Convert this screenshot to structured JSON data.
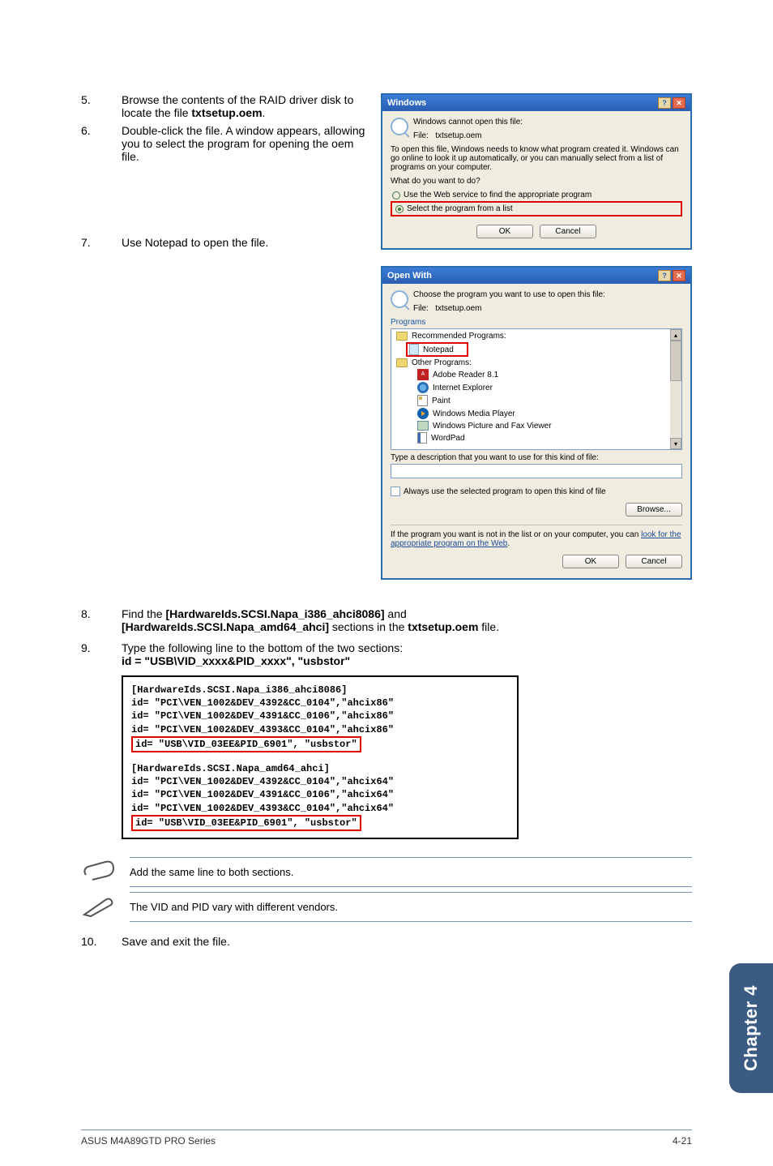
{
  "steps": {
    "s5_num": "5.",
    "s5": "Browse the contents of the RAID driver disk to locate the file ",
    "s5_bold": "txtsetup.oem",
    "s5_tail": ".",
    "s6_num": "6.",
    "s6": "Double-click the file. A window appears, allowing you to select the program for opening the oem file.",
    "s7_num": "7.",
    "s7": "Use Notepad to open the file.",
    "s8_num": "8.",
    "s8_a": "Find the ",
    "s8_b1": "[HardwareIds.SCSI.Napa_i386_ahci8086]",
    "s8_mid": " and ",
    "s8_b2": "[HardwareIds.SCSI.Napa_amd64_ahci]",
    "s8_c": " sections in the ",
    "s8_b3": "txtsetup.oem",
    "s8_d": " file.",
    "s9_num": "9.",
    "s9_a": "Type the following line to the bottom of the two sections:",
    "s9_b": "id = \"USB\\VID_xxxx&PID_xxxx\", \"usbstor\"",
    "s10_num": "10.",
    "s10": "Save and exit the file."
  },
  "dlg1": {
    "title": "Windows",
    "cannot": "Windows cannot open this file:",
    "file_lbl": "File:",
    "file_val": "txtsetup.oem",
    "explain": "To open this file, Windows needs to know what program created it.  Windows can go online to look it up automatically, or you can manually select from a list of programs on your computer.",
    "what": "What do you want to do?",
    "opt_web": "Use the Web service to find the appropriate program",
    "opt_list": "Select the program from a list",
    "ok": "OK",
    "cancel": "Cancel"
  },
  "dlg2": {
    "title": "Open With",
    "choose": "Choose the program you want to use to open this file:",
    "file_lbl": "File:",
    "file_val": "txtsetup.oem",
    "programs_lbl": "Programs",
    "grp_rec": "Recommended Programs:",
    "notepad": "Notepad",
    "grp_other": "Other Programs:",
    "adobe": "Adobe Reader 8.1",
    "ie": "Internet Explorer",
    "paint": "Paint",
    "wmp": "Windows Media Player",
    "pic": "Windows Picture and Fax Viewer",
    "wordpad": "WordPad",
    "desc": "Type a description that you want to use for this kind of file:",
    "always": "Always use the selected program to open this kind of file",
    "browse": "Browse...",
    "link_a": "If the program you want is not in the list or on your computer, you can ",
    "link_b": "look for the appropriate program on the Web",
    "link_c": ".",
    "ok": "OK",
    "cancel": "Cancel"
  },
  "code": {
    "l1": "[HardwareIds.SCSI.Napa_i386_ahci8086]",
    "l2": "id= \"PCI\\VEN_1002&DEV_4392&CC_0104\",\"ahcix86\"",
    "l3": "id= \"PCI\\VEN_1002&DEV_4391&CC_0106\",\"ahcix86\"",
    "l4": "id= \"PCI\\VEN_1002&DEV_4393&CC_0104\",\"ahcix86\"",
    "l5": "id= \"USB\\VID_03EE&PID_6901\", \"usbstor\"",
    "l6": "[HardwareIds.SCSI.Napa_amd64_ahci]",
    "l7": "id= \"PCI\\VEN_1002&DEV_4392&CC_0104\",\"ahcix64\"",
    "l8": "id= \"PCI\\VEN_1002&DEV_4391&CC_0106\",\"ahcix64\"",
    "l9": "id= \"PCI\\VEN_1002&DEV_4393&CC_0104\",\"ahcix64\"",
    "l10": "id= \"USB\\VID_03EE&PID_6901\", \"usbstor\""
  },
  "notes": {
    "n1": "Add the same line to both sections.",
    "n2": "The VID and PID vary with different vendors."
  },
  "chapter_tab": "Chapter 4",
  "footer_left": "ASUS M4A89GTD PRO Series",
  "footer_right": "4-21"
}
